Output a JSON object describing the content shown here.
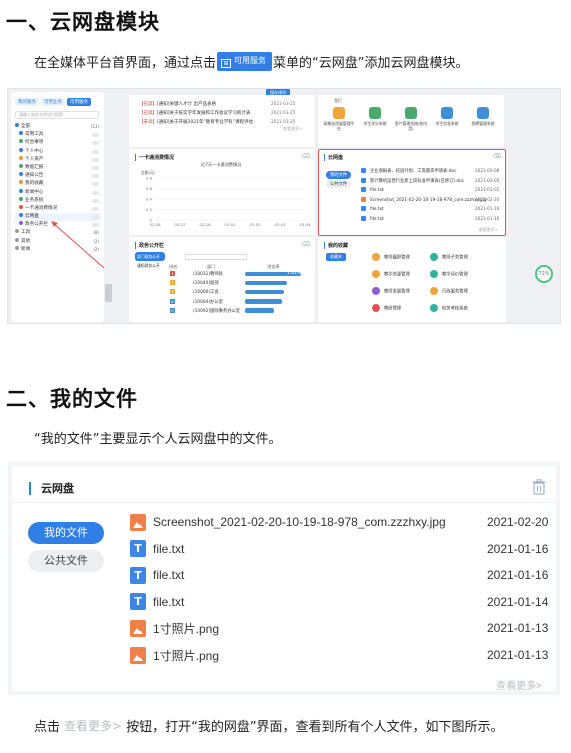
{
  "section1": {
    "heading": "一、云网盘模块",
    "intro_before": "在全媒体平台首界面，通过点击",
    "inline_button_label": "可用服务",
    "intro_after": "菜单的“云网盘”添加云网盘模块。"
  },
  "portal_mockup": {
    "side_tabs": [
      "我的服务",
      "可用业务",
      "可用服务"
    ],
    "side_search_placeholder": "请输入服务名称进行搜索",
    "tree": [
      {
        "label": "全部",
        "count": "(13)",
        "color": "#2f7fe6"
      },
      {
        "label": "常用工具",
        "color": "#2f7fe6"
      },
      {
        "label": "综合事项",
        "color": "#4aa96c"
      },
      {
        "label": "个人中心",
        "color": "#2f7fe6"
      },
      {
        "label": "个人资产",
        "color": "#e69a2f"
      },
      {
        "label": "数据汇报",
        "color": "#4aa96c"
      },
      {
        "label": "通知公告",
        "color": "#2f7fe6"
      },
      {
        "label": "我的收藏",
        "color": "#e69a2f"
      },
      {
        "label": "新闻中心",
        "color": "#2f7fe6"
      },
      {
        "label": "业务系统",
        "color": "#4aa96c"
      },
      {
        "label": "一卡通消费情况",
        "color": "#e05353"
      },
      {
        "label": "云网盘",
        "color": "#2f7fe6"
      },
      {
        "label": "政务公开栏",
        "color": "#8a5cd6"
      },
      {
        "label": "工具",
        "count": "(8)",
        "color": "#999999"
      },
      {
        "label": "其他",
        "count": "(2)",
        "color": "#999999"
      },
      {
        "label": "新闻",
        "count": "(2)",
        "color": "#999999"
      }
    ],
    "top_right_btn": "保存排列",
    "news": [
      {
        "tag": "【已读】",
        "text": "[通知]关键人才计 出产品表格",
        "date": "2021-03-25"
      },
      {
        "tag": "【已读】",
        "text": "[通知]关于核实学年发展和工作会议学习统计表",
        "date": "2021-03-25"
      },
      {
        "tag": "【未读】",
        "text": "[通知]关于开展2021年“教育专业学科”课程评估",
        "date": "2021-03-25"
      }
    ],
    "news_more": "查看更多>",
    "apps": [
      {
        "label": "网格化质量管理平台",
        "color": "#f2a33a"
      },
      {
        "label": "学生学分系统",
        "color": "#4aa96c"
      },
      {
        "label": "资产管理系统(校内用)",
        "color": "#4aa96c"
      },
      {
        "label": "学生信息系统",
        "color": "#3e8fd6"
      },
      {
        "label": "招聘管理系统",
        "color": "#3e8fd6"
      }
    ],
    "apps_header": "我们",
    "card_consume_title": "一卡通消费情况",
    "chart_caption": "近7天一卡通消费情况",
    "chart_unit": "金额(元)",
    "chart_x": [
      "02-26",
      "02-27",
      "02-28",
      "03-01",
      "03-02",
      "03-03",
      "03-04"
    ],
    "chart_y": [
      "0.8",
      "0.6",
      "0.4",
      "0.2",
      "0"
    ],
    "cloud_title": "云网盘",
    "cloud_tabs": [
      "我的文件",
      "公共文件"
    ],
    "cloud_files": [
      {
        "name": "企业商报表、校园计划、工资薪资申请表.doc",
        "date": "2021-03-08",
        "kind": "doc"
      },
      {
        "name": "新计算机运营行业新上岗标准申请表(已修订).doc",
        "date": "2021-03-05",
        "kind": "doc"
      },
      {
        "name": "file.txt",
        "date": "2021-03-02",
        "kind": "txt"
      },
      {
        "name": "Screenshot_2021-02-20-10-19-18-978_com.zzzhxy.jpg",
        "date": "2021-02-20",
        "kind": "img"
      },
      {
        "name": "file.txt",
        "date": "2021-01-16",
        "kind": "txt"
      },
      {
        "name": "file.txt",
        "date": "2021-01-16",
        "kind": "txt"
      }
    ],
    "cloud_more": "查看更多>",
    "gov_title": "政务公开栏",
    "gov_tabs": [
      "部门政务公开",
      "通知政务公开"
    ],
    "gov_cols": [
      "排名",
      "部门",
      "浏览率"
    ],
    "gov_rows": [
      {
        "rank": "1",
        "dept": "(10031)教师处",
        "rate": "1.91%"
      },
      {
        "rank": "2",
        "dept": "(10040)副部",
        "rate": "1.43%"
      },
      {
        "rank": "3",
        "dept": "(10000)工会",
        "rate": "1.33%"
      },
      {
        "rank": "4",
        "dept": "(10004)办公室",
        "rate": "1.26%"
      },
      {
        "rank": "5",
        "dept": "(10092)国际事务办公室",
        "rate": "1.00%"
      }
    ],
    "fav_title": "我的收藏",
    "fav_tab": "收藏夹",
    "quick": [
      {
        "label": "教师履职管理",
        "color": "#f2a33a"
      },
      {
        "label": "教师子务管理",
        "color": "#2fb3a0"
      },
      {
        "label": "教学资源管理",
        "color": "#f2a33a"
      },
      {
        "label": "教学评价管理",
        "color": "#2fb3a0"
      },
      {
        "label": "教师发展管理",
        "color": "#8a5cd6"
      },
      {
        "label": "行政服务管理",
        "color": "#f2a33a"
      },
      {
        "label": "教研管理",
        "color": "#e05353"
      },
      {
        "label": "校务考核系统",
        "color": "#2fb3a0"
      }
    ],
    "progress_badge": "72%"
  },
  "section2": {
    "heading": "二、我的文件",
    "intro": "“我的文件”主要显示个人云网盘中的文件。"
  },
  "cloud_card": {
    "title": "云网盘",
    "tab_active": "我的文件",
    "tab_inactive": "公共文件",
    "files": [
      {
        "name": "Screenshot_2021-02-20-10-19-18-978_com.zzzhxy.jpg",
        "date": "2021-02-20",
        "kind": "img"
      },
      {
        "name": "file.txt",
        "date": "2021-01-16",
        "kind": "txt"
      },
      {
        "name": "file.txt",
        "date": "2021-01-16",
        "kind": "txt"
      },
      {
        "name": "file.txt",
        "date": "2021-01-14",
        "kind": "txt"
      },
      {
        "name": "1寸照片.png",
        "date": "2021-01-13",
        "kind": "img"
      },
      {
        "name": "1寸照片.png",
        "date": "2021-01-13",
        "kind": "img"
      }
    ],
    "more": "查看更多>"
  },
  "footer": {
    "before": "点击",
    "more_label": "查看更多>",
    "after": "按钮，打开“我的网盘”界面，查看到所有个人文件，如下图所示。"
  },
  "colors": {
    "accent": "#2f7fe6",
    "highlight_border": "#e05353",
    "image_icon": "#f0804a",
    "text_icon": "#3c86e8"
  }
}
